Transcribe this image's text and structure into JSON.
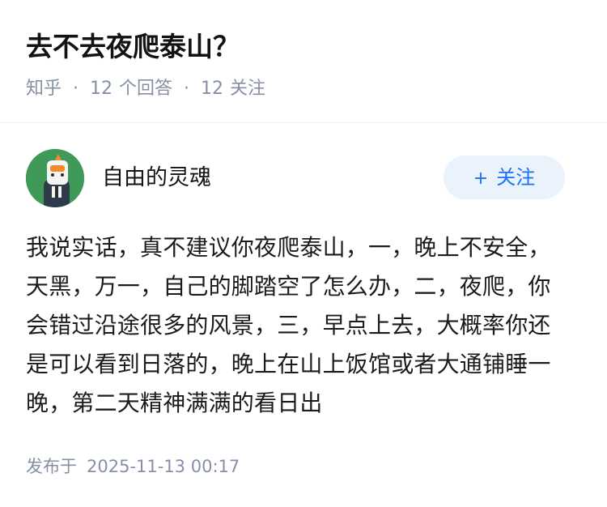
{
  "question": {
    "title": "去不去夜爬泰山？",
    "source": "知乎",
    "answer_count": "12",
    "answer_label": "个回答",
    "follower_count": "12",
    "follower_label": "关注"
  },
  "answer": {
    "author_name": "自由的灵魂",
    "follow_button": {
      "icon": "+",
      "label": "关注"
    },
    "content": "我说实话，真不建议你夜爬泰山，一，晚上不安全，天黑，万一，自己的脚踏空了怎么办，二，夜爬，你会错过沿途很多的风景，三，早点上去，大概率你还是可以看到日落的，晚上在山上饭馆或者大通铺睡一晚，第二天精神满满的看日出",
    "published_label": "发布于",
    "published_time": "2025-11-13 00:17"
  },
  "colors": {
    "accent": "#1772f6",
    "button_bg": "#eaf2fb",
    "meta_gray": "#8590a6",
    "avatar_bg": "#3f9a5a"
  },
  "icons": {
    "avatar": "cartoon-avatar-icon",
    "follow": "plus-icon"
  }
}
